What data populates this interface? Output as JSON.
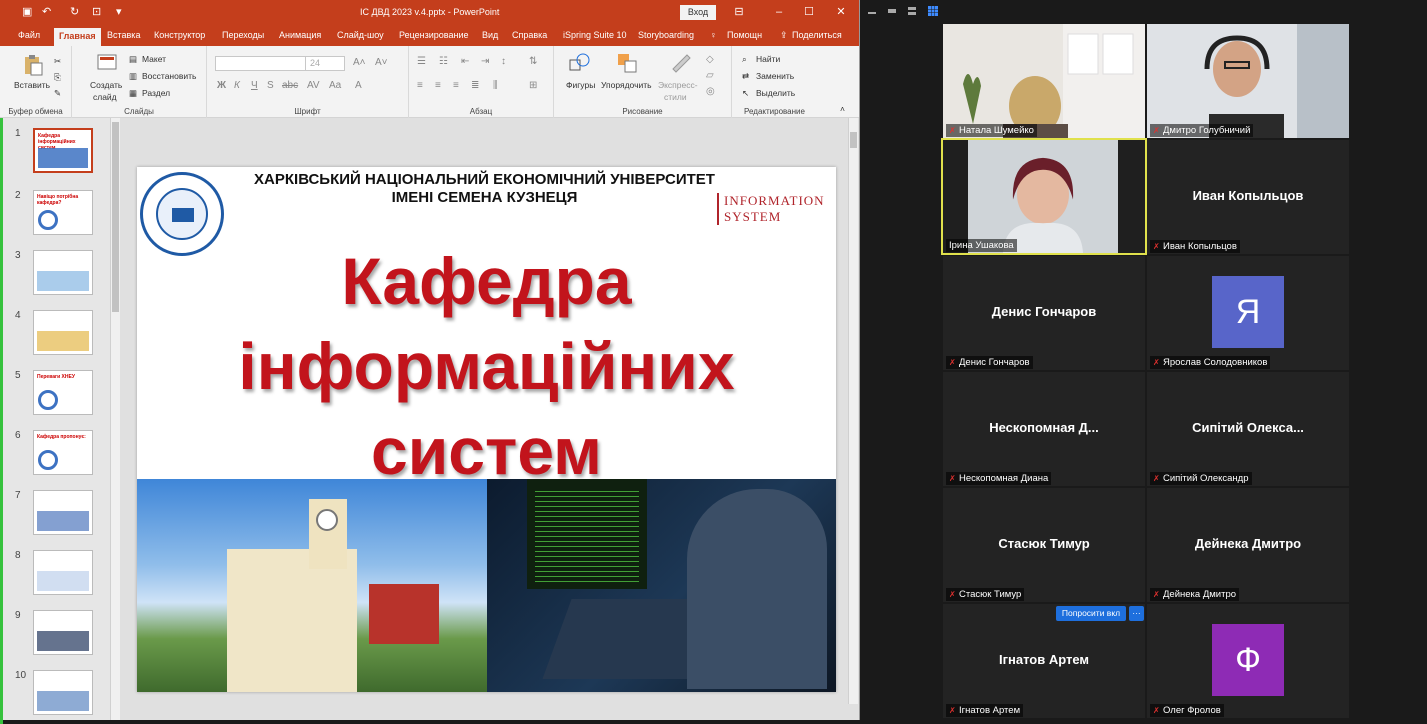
{
  "ppt": {
    "window_title": "ІС ДВД 2023 v.4.pptx  -  PowerPoint",
    "signin_label": "Вход",
    "tabs": [
      {
        "label": "Файл"
      },
      {
        "label": "Главная"
      },
      {
        "label": "Вставка"
      },
      {
        "label": "Конструктор"
      },
      {
        "label": "Переходы"
      },
      {
        "label": "Анимация"
      },
      {
        "label": "Слайд-шоу"
      },
      {
        "label": "Рецензирование"
      },
      {
        "label": "Вид"
      },
      {
        "label": "Справка"
      },
      {
        "label": "iSpring Suite 10"
      },
      {
        "label": "Storyboarding"
      },
      {
        "label": "Помощн"
      },
      {
        "label": "Поделиться"
      }
    ],
    "ribbon": {
      "paste": "Вставить",
      "clipboard_group": "Буфер обмена",
      "new_slide": "Создать",
      "new_slide_2": "слайд",
      "layout": "Макет",
      "reset": "Восстановить",
      "section": "Раздел",
      "slides_group": "Слайды",
      "font_size": "24",
      "font_group": "Шрифт",
      "paragraph_group": "Абзац",
      "shapes": "Фигуры",
      "arrange": "Упорядочить",
      "quick_styles": "Экспресс-",
      "quick_styles_2": "стили",
      "drawing_group": "Рисование",
      "find": "Найти",
      "replace": "Заменить",
      "select": "Выделить",
      "editing_group": "Редактирование"
    },
    "thumbnails": [
      {
        "num": "1",
        "title": "Кафедра інформаційних систем"
      },
      {
        "num": "2",
        "title": "Навіщо потрібна кафедра?"
      },
      {
        "num": "3",
        "title": ""
      },
      {
        "num": "4",
        "title": ""
      },
      {
        "num": "5",
        "title": "Переваги ХНЕУ"
      },
      {
        "num": "6",
        "title": "Кафедра пропонує:"
      },
      {
        "num": "7",
        "title": ""
      },
      {
        "num": "8",
        "title": ""
      },
      {
        "num": "9",
        "title": ""
      },
      {
        "num": "10",
        "title": ""
      }
    ],
    "slide": {
      "univ_line1": "ХАРКІВСЬКИЙ НАЦІОНАЛЬНИЙ ЕКОНОМІЧНИЙ УНІВЕРСИТЕТ",
      "univ_line2": "ІМЕНІ СЕМЕНА КУЗНЕЦЯ",
      "logo_line1": "INFORMATION",
      "logo_line2": "SYSTEM",
      "title_line1": "Кафедра",
      "title_line2": "інформаційних",
      "title_line3": "систем"
    }
  },
  "zoom": {
    "participants": [
      {
        "label": "Натала Шумейко",
        "name": ""
      },
      {
        "label": "Дмитро Голубничий",
        "name": ""
      },
      {
        "label": "Ірина Ушакова",
        "name": ""
      },
      {
        "label": "Иван Копыльцов",
        "name": "Иван Копыльцов"
      },
      {
        "label": "Денис Гончаров",
        "name": "Денис Гончаров"
      },
      {
        "label": "Ярослав Солодовников",
        "name": "",
        "avatar": "Я"
      },
      {
        "label": "Нескопомная Диана",
        "name": "Нескопомная  Д..."
      },
      {
        "label": "Сипітий Олександр",
        "name": "Сипітий  Олекса..."
      },
      {
        "label": "Стасюк Тимур",
        "name": "Стасюк Тимур"
      },
      {
        "label": "Дейнека Дмитро",
        "name": "Дейнека Дмитро"
      },
      {
        "label": "Ігнатов Артем",
        "name": "Ігнатов Артем"
      },
      {
        "label": "Олег Фролов",
        "name": "",
        "avatar": "Ф"
      }
    ],
    "ask_unmute": "Попросити вкл",
    "more": "···",
    "colors": {
      "active_border": "#e0e14c",
      "avatar_ya": "#5865c9",
      "avatar_f": "#8e2bb5",
      "muted": "#e0312f"
    }
  }
}
